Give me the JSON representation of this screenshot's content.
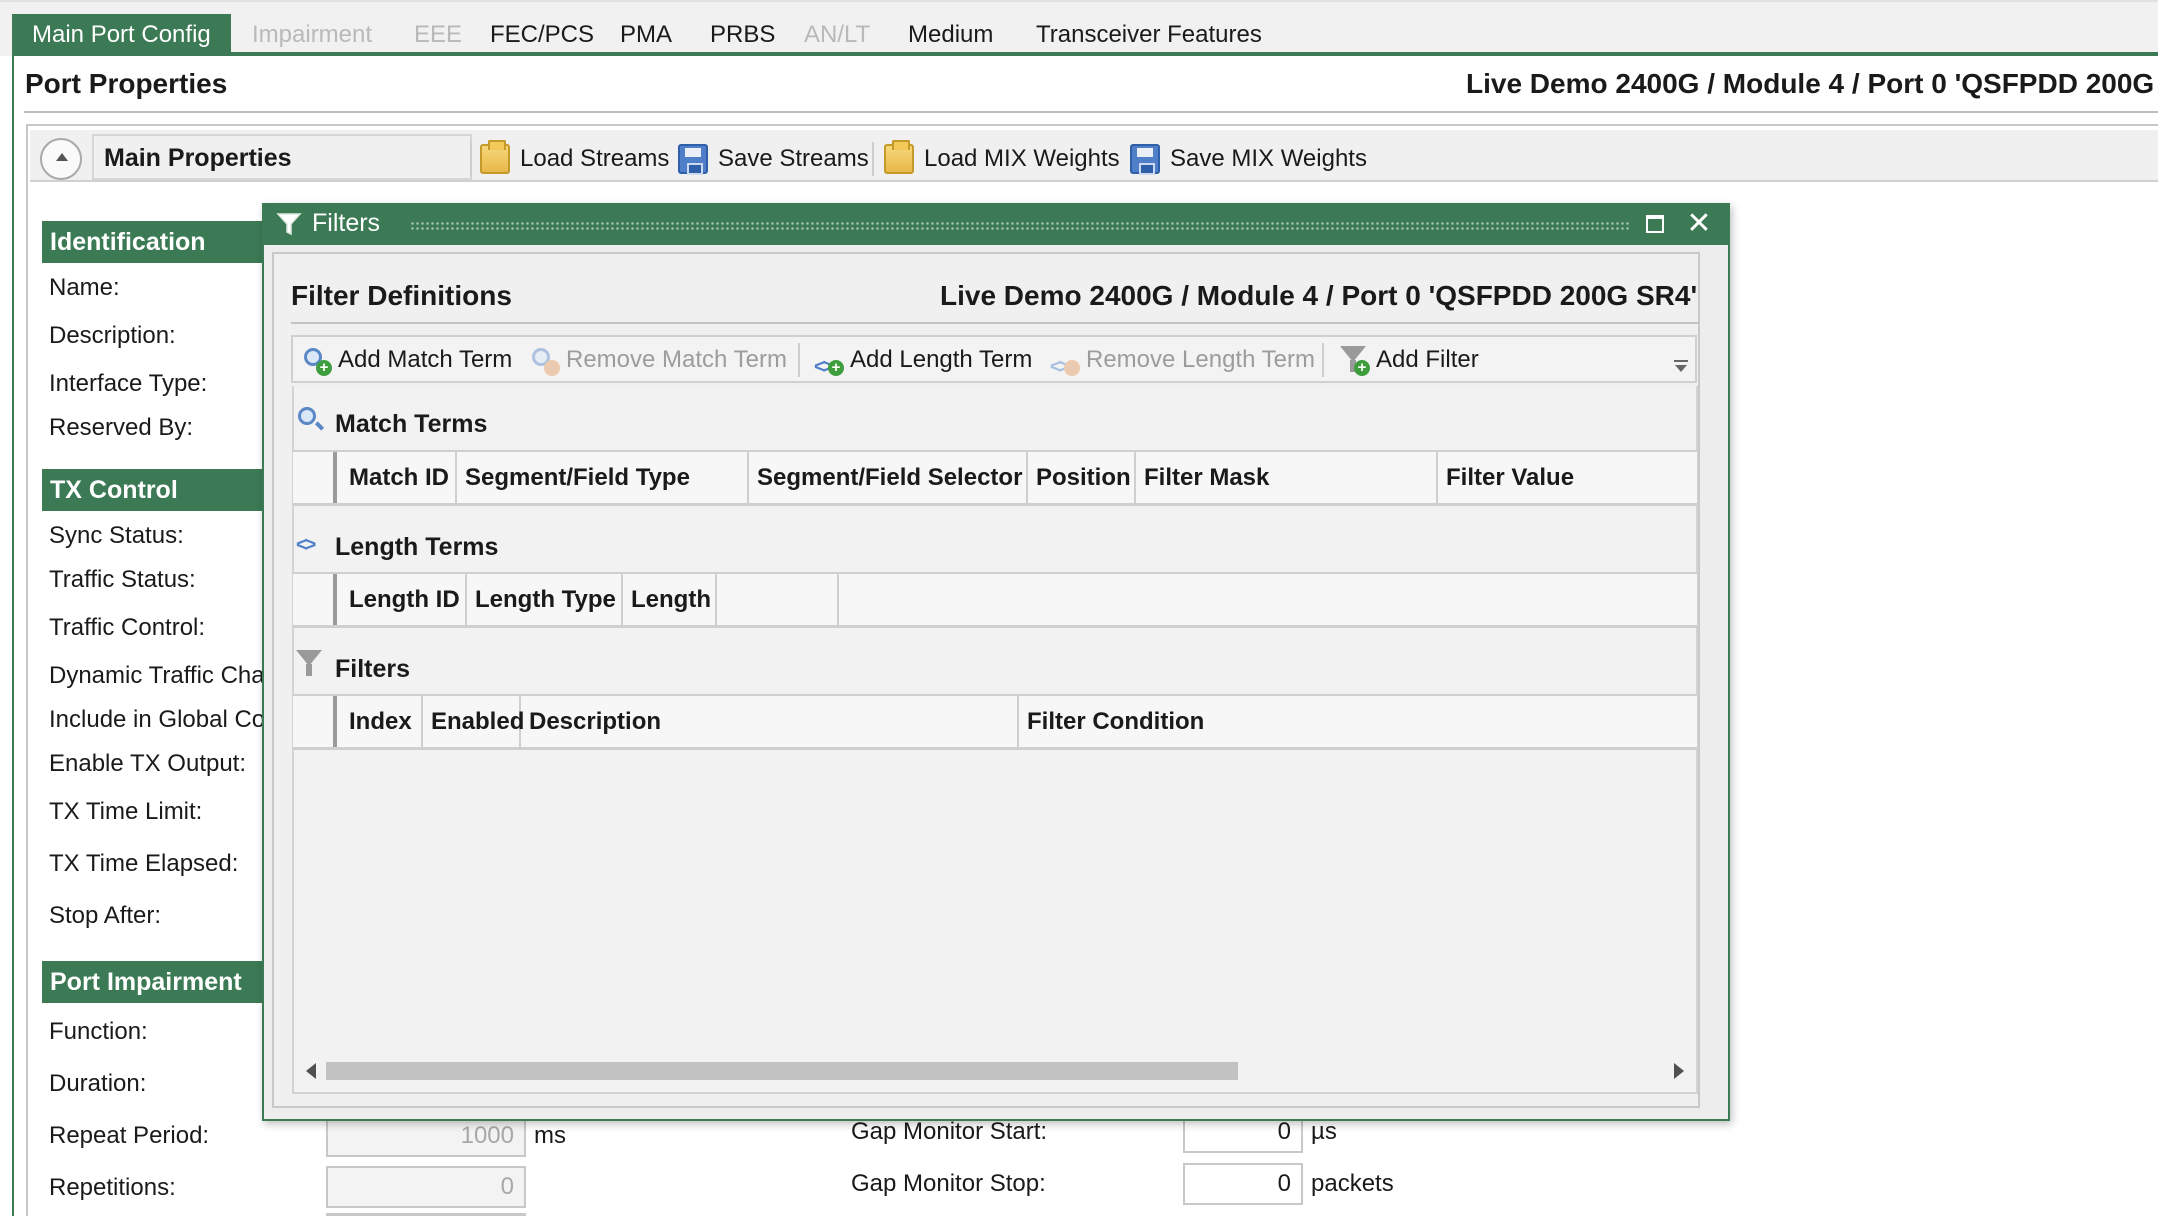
{
  "tabs": [
    {
      "label": "Main Port Config",
      "state": "active"
    },
    {
      "label": "Impairment",
      "state": "disabled"
    },
    {
      "label": "EEE",
      "state": "disabled"
    },
    {
      "label": "FEC/PCS",
      "state": "normal"
    },
    {
      "label": "PMA",
      "state": "normal"
    },
    {
      "label": "PRBS",
      "state": "normal"
    },
    {
      "label": "AN/LT",
      "state": "disabled"
    },
    {
      "label": "Medium",
      "state": "normal"
    },
    {
      "label": "Transceiver Features",
      "state": "normal"
    }
  ],
  "port_properties": {
    "title": "Port Properties",
    "path": "Live Demo 2400G / Module 4 / Port 0 'QSFPDD 200G"
  },
  "main_toolbar": {
    "section_label": "Main Properties",
    "load_streams": "Load Streams",
    "save_streams": "Save Streams",
    "load_mix": "Load MIX Weights",
    "save_mix": "Save MIX Weights"
  },
  "sections": {
    "identification": {
      "title": "Identification",
      "labels": [
        "Name:",
        "Description:",
        "Interface Type:",
        "Reserved By:"
      ]
    },
    "tx_control": {
      "title": "TX Control",
      "labels": [
        "Sync Status:",
        "Traffic Status:",
        "Traffic Control:",
        "Dynamic Traffic Char",
        "Include in Global Co",
        "Enable TX Output:",
        "TX Time Limit:",
        "TX Time Elapsed:",
        "Stop After:"
      ]
    },
    "port_impairment": {
      "title": "Port Impairment",
      "labels": [
        "Function:",
        "Duration:",
        "Repeat Period:",
        "Repetitions:"
      ],
      "repeat_period_value": "1000",
      "repeat_period_unit": "ms",
      "repetitions_value": "0"
    }
  },
  "gap_monitor": {
    "start_label": "Gap Monitor Start:",
    "start_value": "0",
    "start_unit": "µs",
    "stop_label": "Gap Monitor Stop:",
    "stop_value": "0",
    "stop_unit": "packets"
  },
  "dialog": {
    "title": "Filters",
    "heading": "Filter Definitions",
    "path": "Live Demo 2400G / Module 4 / Port 0 'QSFPDD 200G SR4'",
    "toolbar": {
      "add_match": "Add Match Term",
      "remove_match": "Remove Match Term",
      "add_length": "Add Length Term",
      "remove_length": "Remove Length Term",
      "add_filter": "Add Filter"
    },
    "match_terms": {
      "title": "Match Terms",
      "columns": [
        "Match ID",
        "Segment/Field Type",
        "Segment/Field Selector",
        "Position",
        "Filter Mask",
        "Filter Value"
      ]
    },
    "length_terms": {
      "title": "Length Terms",
      "columns": [
        "Length ID",
        "Length Type",
        "Length",
        ""
      ]
    },
    "filters": {
      "title": "Filters",
      "columns": [
        "Index",
        "Enabled",
        "Description",
        "Filter Condition"
      ]
    }
  }
}
